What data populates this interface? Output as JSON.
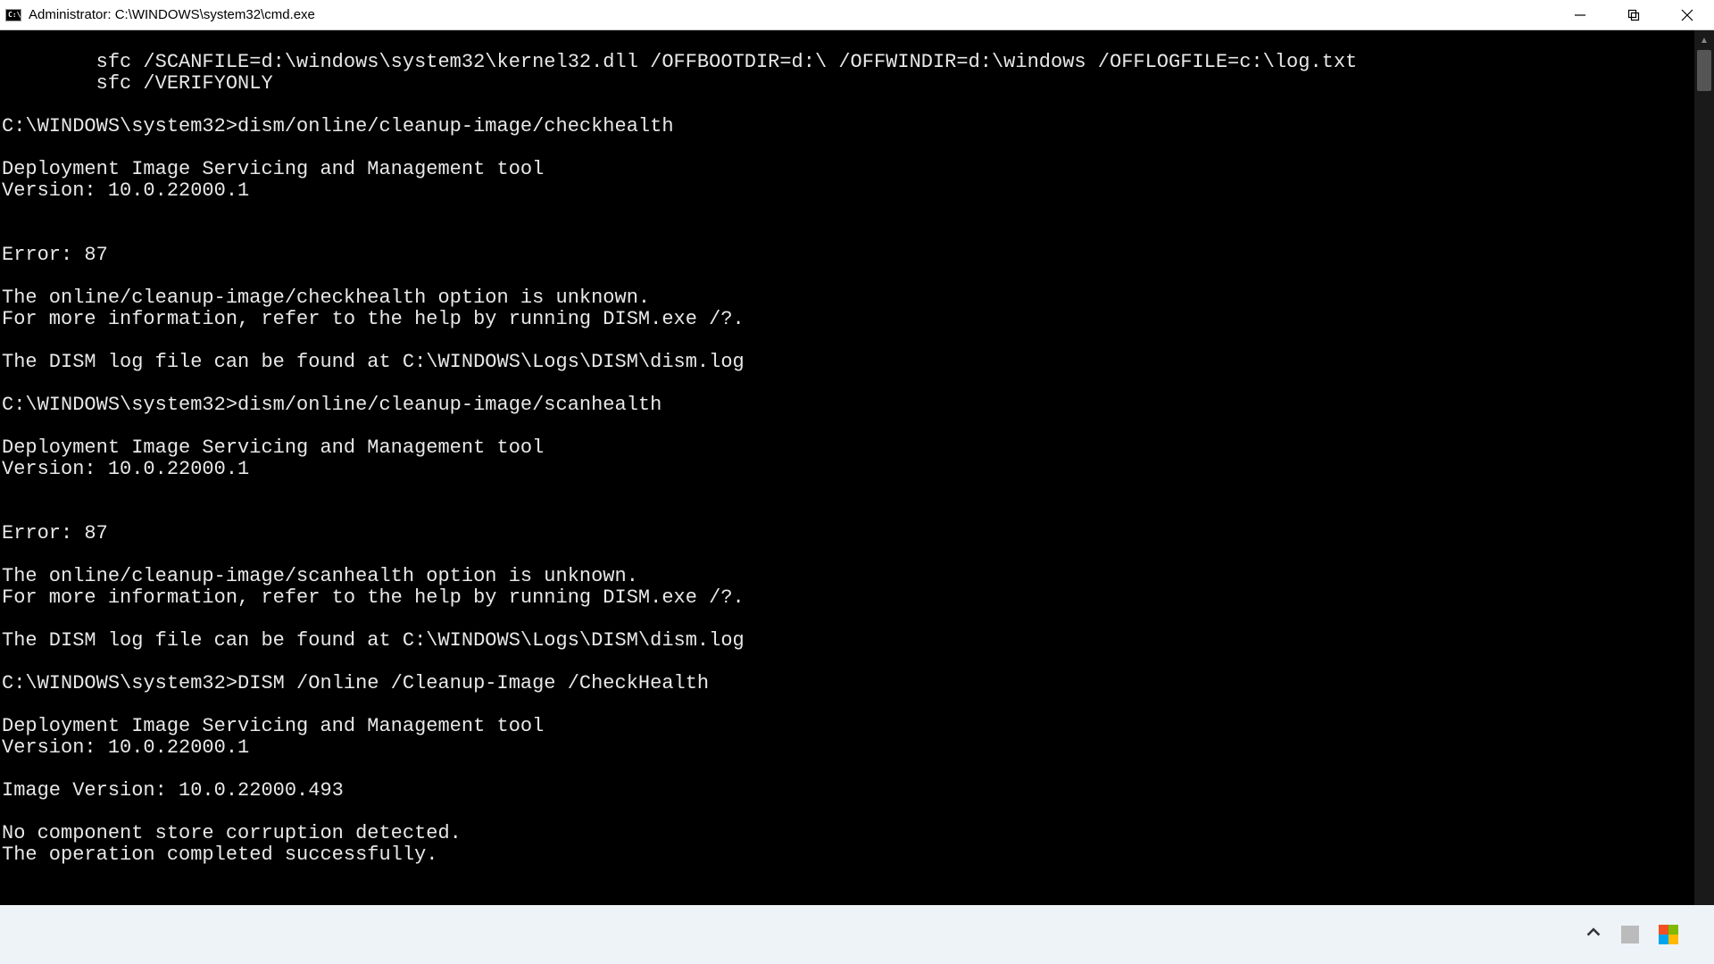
{
  "window": {
    "icon_label": "C:\\",
    "title": "Administrator: C:\\WINDOWS\\system32\\cmd.exe"
  },
  "console": {
    "lines": [
      "        sfc /SCANFILE=d:\\windows\\system32\\kernel32.dll /OFFBOOTDIR=d:\\ /OFFWINDIR=d:\\windows /OFFLOGFILE=c:\\log.txt",
      "        sfc /VERIFYONLY",
      "",
      "C:\\WINDOWS\\system32>dism/online/cleanup-image/checkhealth",
      "",
      "Deployment Image Servicing and Management tool",
      "Version: 10.0.22000.1",
      "",
      "",
      "Error: 87",
      "",
      "The online/cleanup-image/checkhealth option is unknown.",
      "For more information, refer to the help by running DISM.exe /?.",
      "",
      "The DISM log file can be found at C:\\WINDOWS\\Logs\\DISM\\dism.log",
      "",
      "C:\\WINDOWS\\system32>dism/online/cleanup-image/scanhealth",
      "",
      "Deployment Image Servicing and Management tool",
      "Version: 10.0.22000.1",
      "",
      "",
      "Error: 87",
      "",
      "The online/cleanup-image/scanhealth option is unknown.",
      "For more information, refer to the help by running DISM.exe /?.",
      "",
      "The DISM log file can be found at C:\\WINDOWS\\Logs\\DISM\\dism.log",
      "",
      "C:\\WINDOWS\\system32>DISM /Online /Cleanup-Image /CheckHealth",
      "",
      "Deployment Image Servicing and Management tool",
      "Version: 10.0.22000.1",
      "",
      "Image Version: 10.0.22000.493",
      "",
      "No component store corruption detected.",
      "The operation completed successfully.",
      ""
    ],
    "prompt": "C:\\WINDOWS\\system32>"
  }
}
